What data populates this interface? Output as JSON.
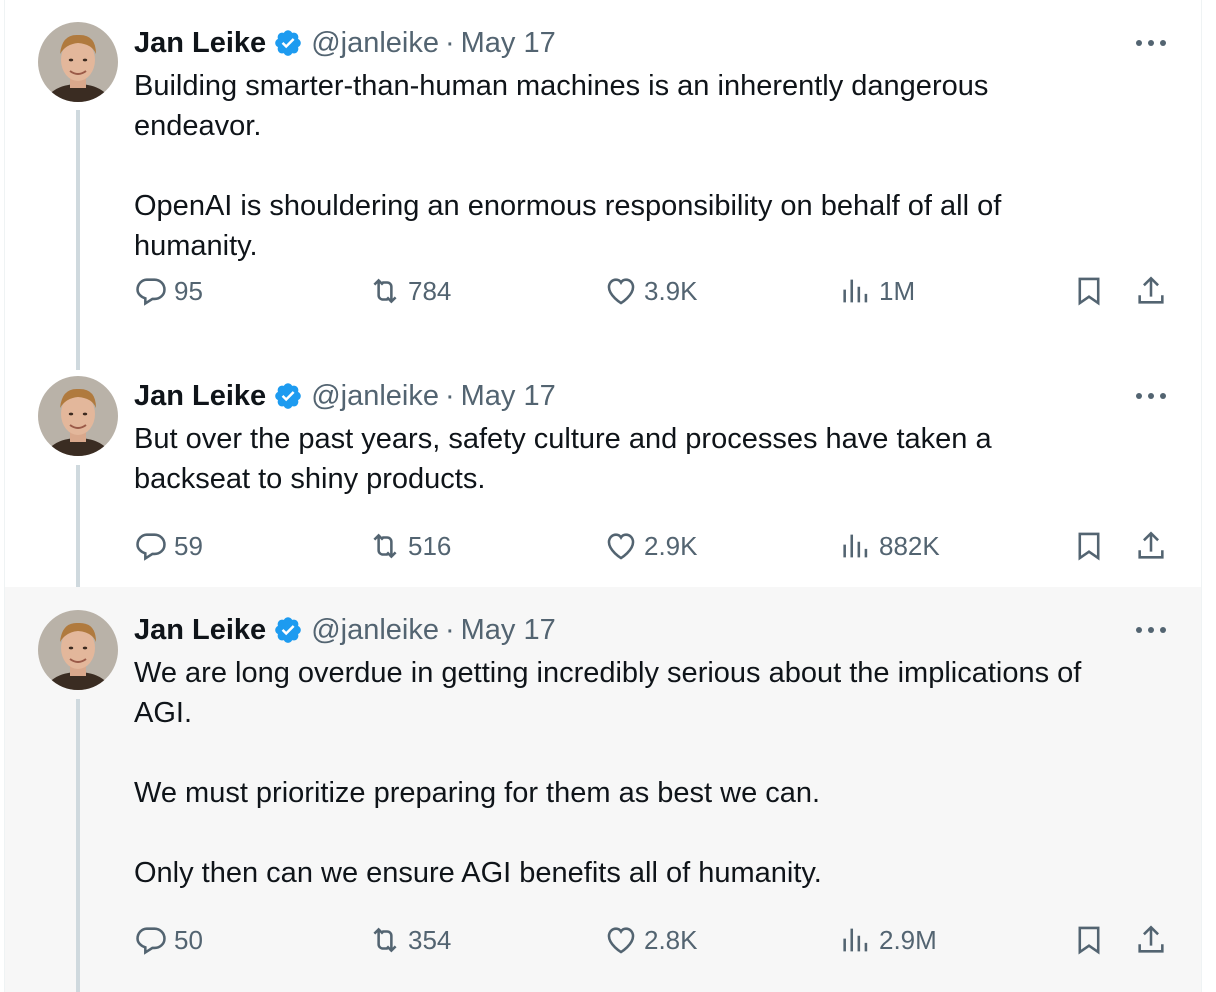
{
  "tweets": [
    {
      "name": "Jan Leike",
      "handle": "@janleike",
      "separator": "·",
      "date": "May 17",
      "text": "Building smarter-than-human machines is an inherently dangerous\nendeavor.\n\nOpenAI is shouldering an enormous responsibility on behalf of all of\nhumanity.",
      "replies": "95",
      "retweets": "784",
      "likes": "3.9K",
      "views": "1M"
    },
    {
      "name": "Jan Leike",
      "handle": "@janleike",
      "separator": "·",
      "date": "May 17",
      "text": "But over the past years, safety culture and processes have taken a\nbackseat to shiny products.",
      "replies": "59",
      "retweets": "516",
      "likes": "2.9K",
      "views": "882K"
    },
    {
      "name": "Jan Leike",
      "handle": "@janleike",
      "separator": "·",
      "date": "May 17",
      "text": "We are long overdue in getting incredibly serious about the implications of\nAGI.\n\nWe must prioritize preparing for them as best we can.\n\nOnly then can we ensure AGI benefits all of humanity.",
      "replies": "50",
      "retweets": "354",
      "likes": "2.8K",
      "views": "2.9M"
    }
  ],
  "colors": {
    "verified": "#1d9bf0",
    "secondary_text": "#536471",
    "thread_line": "#cfd9de",
    "highlight_bg": "#f7f7f7"
  },
  "icons": [
    "reply-icon",
    "retweet-icon",
    "like-icon",
    "views-icon",
    "bookmark-icon",
    "share-icon",
    "more-icon",
    "verified-badge-icon"
  ]
}
